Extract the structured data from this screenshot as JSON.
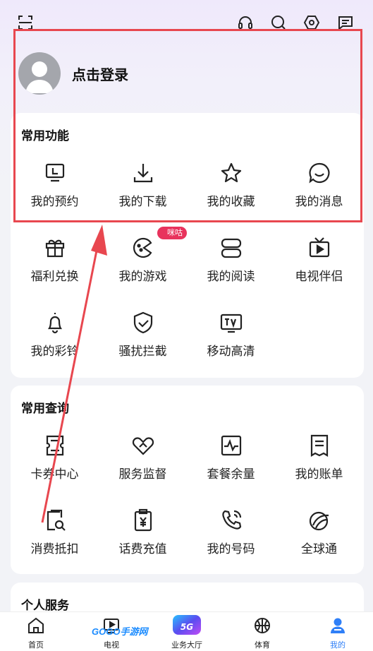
{
  "header": {
    "icons": [
      "scan-icon",
      "headset-icon",
      "search-icon",
      "settings-hexagon-icon",
      "message-icon"
    ]
  },
  "profile": {
    "login_text": "点击登录"
  },
  "common_functions": {
    "title": "常用功能",
    "items": [
      {
        "label": "我的预约",
        "icon": "monitor-icon"
      },
      {
        "label": "我的下载",
        "icon": "download-icon"
      },
      {
        "label": "我的收藏",
        "icon": "star-icon"
      },
      {
        "label": "我的消息",
        "icon": "smile-message-icon"
      },
      {
        "label": "福利兑换",
        "icon": "gift-icon"
      },
      {
        "label": "我的游戏",
        "icon": "gamepad-icon",
        "badge": "咪咕"
      },
      {
        "label": "我的阅读",
        "icon": "book-icon"
      },
      {
        "label": "电视伴侣",
        "icon": "tv-icon"
      },
      {
        "label": "我的彩铃",
        "icon": "bell-icon"
      },
      {
        "label": "骚扰拦截",
        "icon": "shield-check-icon"
      },
      {
        "label": "移动高清",
        "icon": "tv-box-icon"
      }
    ]
  },
  "common_queries": {
    "title": "常用查询",
    "items": [
      {
        "label": "卡券中心",
        "icon": "coupon-icon"
      },
      {
        "label": "服务监督",
        "icon": "handshake-icon"
      },
      {
        "label": "套餐余量",
        "icon": "pulse-icon"
      },
      {
        "label": "我的账单",
        "icon": "bill-icon"
      },
      {
        "label": "消费抵扣",
        "icon": "receipt-search-icon"
      },
      {
        "label": "话费充值",
        "icon": "recharge-icon"
      },
      {
        "label": "我的号码",
        "icon": "phone-icon"
      },
      {
        "label": "全球通",
        "icon": "globe-swirl-icon"
      }
    ]
  },
  "personal_services": {
    "title": "个人服务"
  },
  "tabbar": {
    "tabs": [
      {
        "label": "首页",
        "icon": "home-icon"
      },
      {
        "label": "电视",
        "icon": "tv-play-icon"
      },
      {
        "label": "业务大厅",
        "icon": "5g-icon"
      },
      {
        "label": "体育",
        "icon": "basketball-icon"
      },
      {
        "label": "我的",
        "icon": "user-icon",
        "active": true
      }
    ],
    "badge_5g": "5G"
  },
  "watermark": {
    "text": "GOGO手游网"
  },
  "colors": {
    "accent_blue": "#2f7ff7",
    "highlight_red": "#e8474f",
    "badge_pink": "#e8335c"
  }
}
